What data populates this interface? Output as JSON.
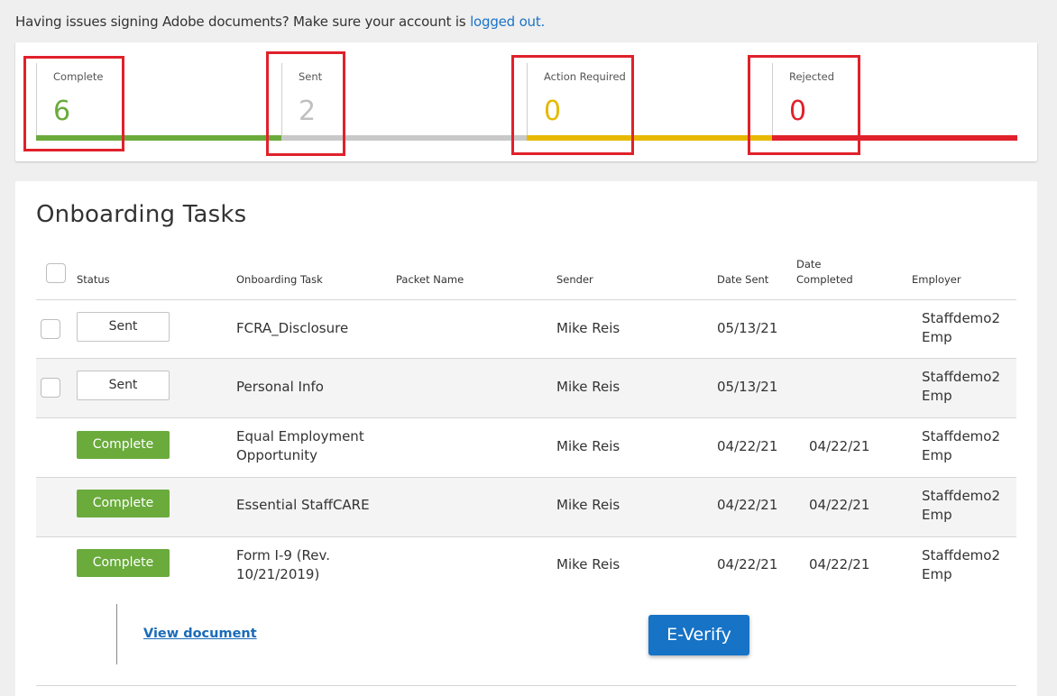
{
  "notice": {
    "text": "Having issues signing Adobe documents? Make sure your account is ",
    "link": "logged out."
  },
  "summary": {
    "stats": [
      {
        "label": "Complete",
        "value": "6",
        "color": "#6aab3c"
      },
      {
        "label": "Sent",
        "value": "2",
        "color": "#c8c8c8"
      },
      {
        "label": "Action Required",
        "value": "0",
        "color": "#e6b800"
      },
      {
        "label": "Rejected",
        "value": "0",
        "color": "#e0212b"
      }
    ]
  },
  "tasks": {
    "title": "Onboarding Tasks",
    "columns": {
      "status": "Status",
      "task": "Onboarding Task",
      "packet": "Packet Name",
      "sender": "Sender",
      "date_sent": "Date Sent",
      "date_completed_1": "Date",
      "date_completed_2": "Completed",
      "employer": "Employer"
    },
    "rows": [
      {
        "status": "Sent",
        "task_1": "FCRA_Disclosure",
        "task_2": "",
        "sender": "Mike Reis",
        "date_sent": "05/13/21",
        "date_completed": "",
        "employer_1": "Staffdemo2",
        "employer_2": "Emp"
      },
      {
        "status": "Sent",
        "task_1": "Personal Info",
        "task_2": "",
        "sender": "Mike Reis",
        "date_sent": "05/13/21",
        "date_completed": "",
        "employer_1": "Staffdemo2",
        "employer_2": "Emp"
      },
      {
        "status": "Complete",
        "task_1": "Equal Employment",
        "task_2": "Opportunity",
        "sender": "Mike Reis",
        "date_sent": "04/22/21",
        "date_completed": "04/22/21",
        "employer_1": "Staffdemo2",
        "employer_2": "Emp"
      },
      {
        "status": "Complete",
        "task_1": "Essential StaffCARE",
        "task_2": "",
        "sender": "Mike Reis",
        "date_sent": "04/22/21",
        "date_completed": "04/22/21",
        "employer_1": "Staffdemo2",
        "employer_2": "Emp"
      },
      {
        "status": "Complete",
        "task_1": "Form I-9 (Rev.",
        "task_2": "10/21/2019)",
        "sender": "Mike Reis",
        "date_sent": "04/22/21",
        "date_completed": "04/22/21",
        "employer_1": "Staffdemo2",
        "employer_2": "Emp"
      }
    ],
    "view_document": "View document",
    "everify": "E-Verify"
  }
}
